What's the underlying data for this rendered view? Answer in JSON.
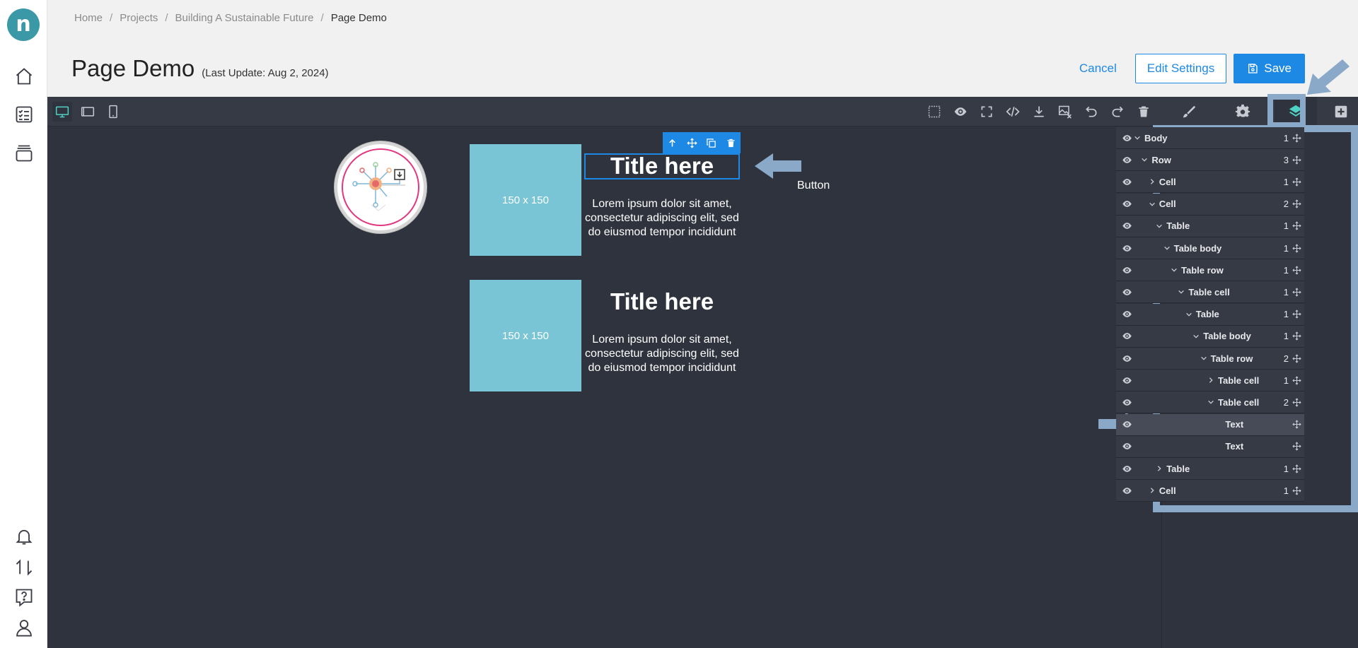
{
  "breadcrumb": [
    "Home",
    "Projects",
    "Building A Sustainable Future",
    "Page Demo"
  ],
  "page": {
    "title": "Page Demo",
    "last_update": "(Last Update: Aug 2, 2024)"
  },
  "header_buttons": {
    "cancel": "Cancel",
    "edit_settings": "Edit Settings",
    "save": "Save"
  },
  "canvas": {
    "placeholder_1": "150 x 150",
    "placeholder_2": "150 x 150",
    "title_1": "Title here",
    "title_2": "Title here",
    "text_1": "Lorem ipsum dolor sit amet, consectetur adipiscing elit, sed do eiusmod tempor incididunt",
    "text_2": "Lorem ipsum dolor sit amet, consectetur adipiscing elit, sed do eiusmod tempor incididunt",
    "annotation_label": "Button"
  },
  "layers": [
    {
      "name": "Body",
      "count": "1",
      "depth": 0,
      "caret": "down"
    },
    {
      "name": "Row",
      "count": "3",
      "depth": 1,
      "caret": "down"
    },
    {
      "name": "Cell",
      "count": "1",
      "depth": 2,
      "caret": "right"
    },
    {
      "name": "Cell",
      "count": "2",
      "depth": 2,
      "caret": "down"
    },
    {
      "name": "Table",
      "count": "1",
      "depth": 3,
      "caret": "down"
    },
    {
      "name": "Table body",
      "count": "1",
      "depth": 4,
      "caret": "down"
    },
    {
      "name": "Table row",
      "count": "1",
      "depth": 5,
      "caret": "down"
    },
    {
      "name": "Table cell",
      "count": "1",
      "depth": 6,
      "caret": "down"
    },
    {
      "name": "Table",
      "count": "1",
      "depth": 7,
      "caret": "down"
    },
    {
      "name": "Table body",
      "count": "1",
      "depth": 8,
      "caret": "down"
    },
    {
      "name": "Table row",
      "count": "2",
      "depth": 9,
      "caret": "down"
    },
    {
      "name": "Table cell",
      "count": "1",
      "depth": 10,
      "caret": "right"
    },
    {
      "name": "Table cell",
      "count": "2",
      "depth": 10,
      "caret": "down"
    },
    {
      "name": "Text",
      "count": "",
      "depth": 11,
      "caret": "none",
      "highlighted": true
    },
    {
      "name": "Text",
      "count": "",
      "depth": 11,
      "caret": "none"
    },
    {
      "name": "Table",
      "count": "1",
      "depth": 3,
      "caret": "right"
    },
    {
      "name": "Cell",
      "count": "1",
      "depth": 2,
      "caret": "right"
    }
  ],
  "colors": {
    "accent": "#1e88e5",
    "active_tool": "#4fd1c5",
    "placeholder": "#7ac5d5",
    "annotation": "#8aa9c9"
  }
}
